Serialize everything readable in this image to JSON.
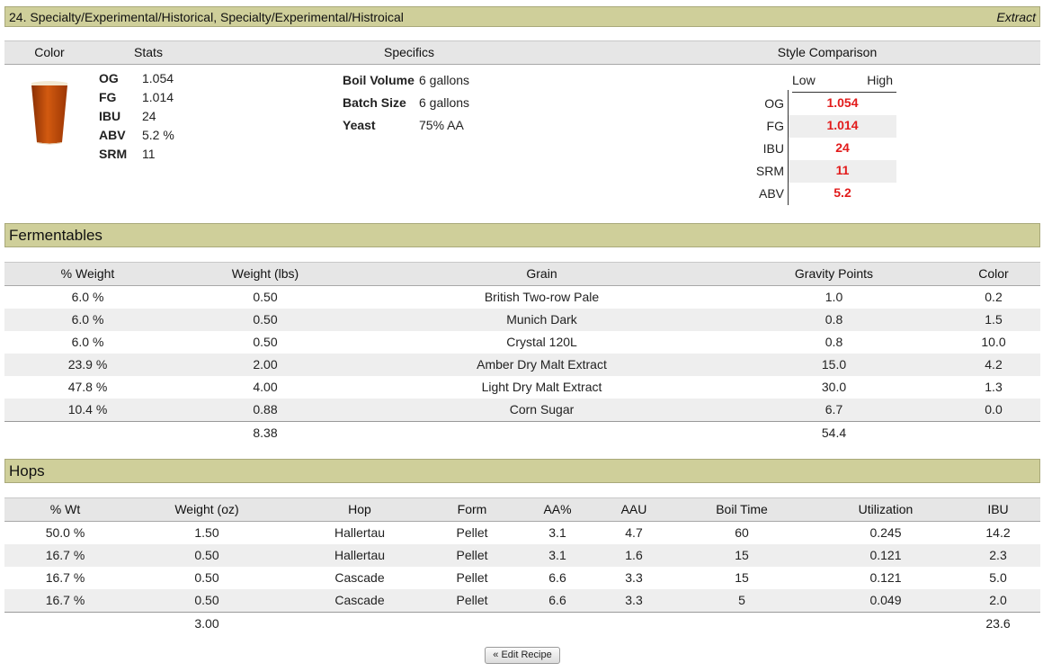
{
  "header": {
    "title": "24. Specialty/Experimental/Historical, Specialty/Experimental/Histroical",
    "type": "Extract"
  },
  "summary": {
    "headings": {
      "color": "Color",
      "stats": "Stats",
      "specifics": "Specifics",
      "comparison": "Style Comparison"
    },
    "beer_color": "#c24a06",
    "stats": [
      {
        "k": "OG",
        "v": "1.054"
      },
      {
        "k": "FG",
        "v": "1.014"
      },
      {
        "k": "IBU",
        "v": "24"
      },
      {
        "k": "ABV",
        "v": "5.2 %"
      },
      {
        "k": "SRM",
        "v": "11"
      }
    ],
    "specifics": [
      {
        "k": "Boil Volume",
        "v": "6 gallons"
      },
      {
        "k": "Batch Size",
        "v": "6 gallons"
      },
      {
        "k": "Yeast",
        "v": "75% AA"
      }
    ],
    "comparison": {
      "low": "Low",
      "high": "High",
      "rows": [
        {
          "k": "OG",
          "v": "1.054"
        },
        {
          "k": "FG",
          "v": "1.014"
        },
        {
          "k": "IBU",
          "v": "24"
        },
        {
          "k": "SRM",
          "v": "11"
        },
        {
          "k": "ABV",
          "v": "5.2"
        }
      ]
    }
  },
  "fermentables": {
    "title": "Fermentables",
    "columns": [
      "% Weight",
      "Weight (lbs)",
      "Grain",
      "Gravity Points",
      "Color"
    ],
    "rows": [
      [
        "6.0 %",
        "0.50",
        "British Two-row Pale",
        "1.0",
        "0.2"
      ],
      [
        "6.0 %",
        "0.50",
        "Munich Dark",
        "0.8",
        "1.5"
      ],
      [
        "6.0 %",
        "0.50",
        "Crystal 120L",
        "0.8",
        "10.0"
      ],
      [
        "23.9 %",
        "2.00",
        "Amber Dry Malt Extract",
        "15.0",
        "4.2"
      ],
      [
        "47.8 %",
        "4.00",
        "Light Dry Malt Extract",
        "30.0",
        "1.3"
      ],
      [
        "10.4 %",
        "0.88",
        "Corn Sugar",
        "6.7",
        "0.0"
      ]
    ],
    "totals": {
      "weight": "8.38",
      "gravity": "54.4"
    }
  },
  "hops": {
    "title": "Hops",
    "columns": [
      "% Wt",
      "Weight (oz)",
      "Hop",
      "Form",
      "AA%",
      "AAU",
      "Boil Time",
      "Utilization",
      "IBU"
    ],
    "rows": [
      [
        "50.0 %",
        "1.50",
        "Hallertau",
        "Pellet",
        "3.1",
        "4.7",
        "60",
        "0.245",
        "14.2"
      ],
      [
        "16.7 %",
        "0.50",
        "Hallertau",
        "Pellet",
        "3.1",
        "1.6",
        "15",
        "0.121",
        "2.3"
      ],
      [
        "16.7 %",
        "0.50",
        "Cascade",
        "Pellet",
        "6.6",
        "3.3",
        "15",
        "0.121",
        "5.0"
      ],
      [
        "16.7 %",
        "0.50",
        "Cascade",
        "Pellet",
        "6.6",
        "3.3",
        "5",
        "0.049",
        "2.0"
      ]
    ],
    "totals": {
      "weight": "3.00",
      "ibu": "23.6"
    }
  },
  "actions": {
    "edit": "« Edit Recipe"
  }
}
